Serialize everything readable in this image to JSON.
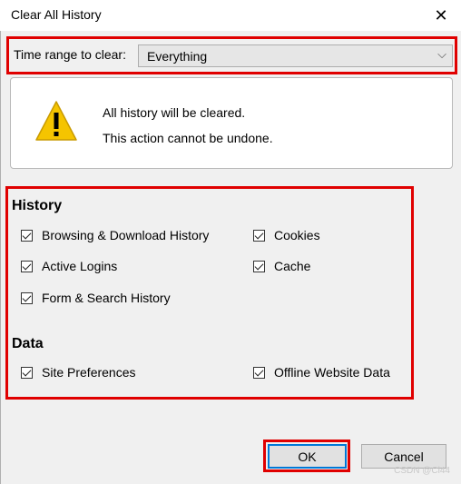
{
  "window": {
    "title": "Clear All History",
    "close_glyph": "✕"
  },
  "time_range": {
    "label": "Time range to clear:",
    "value": "Everything",
    "chevron": "⌵"
  },
  "warning": {
    "icon": "warning-icon",
    "line1": "All history will be cleared.",
    "line2": "This action cannot be undone."
  },
  "history": {
    "heading": "History",
    "items": [
      {
        "label": "Browsing & Download History",
        "checked": true
      },
      {
        "label": "Cookies",
        "checked": true
      },
      {
        "label": "Active Logins",
        "checked": true
      },
      {
        "label": "Cache",
        "checked": true
      },
      {
        "label": "Form & Search History",
        "checked": true
      }
    ]
  },
  "data_section": {
    "heading": "Data",
    "items": [
      {
        "label": "Site Preferences",
        "checked": true
      },
      {
        "label": "Offline Website Data",
        "checked": true
      }
    ]
  },
  "buttons": {
    "ok": "OK",
    "cancel": "Cancel"
  },
  "watermark": "CSDN @Cl44",
  "colors": {
    "highlight": "#e00000",
    "focus": "#0078d7",
    "warning": "#f5c400"
  }
}
